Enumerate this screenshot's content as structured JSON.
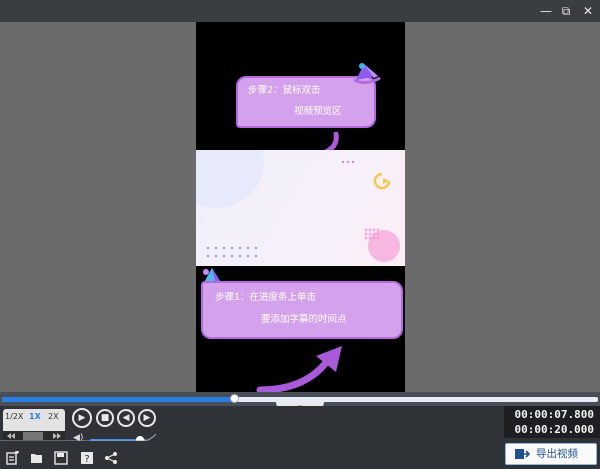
{
  "window": {
    "minimize_glyph": "—",
    "maximize_glyph": "⧉",
    "close_glyph": "✕"
  },
  "preview": {
    "step2_line1": "步骤2：鼠标双击",
    "step2_line2": "视频预览区",
    "step1_line1": "步骤1：在进度条上单击",
    "step1_line2": "要添加字幕的时间点"
  },
  "playback": {
    "progress": 0.39,
    "speed_options": [
      "1/2X",
      "1X",
      "2X"
    ],
    "selected_speed": "1X",
    "volume": 0.9,
    "current_time": "00:00:07.800",
    "total_time": "00:00:20.000"
  },
  "toolbar": {
    "export_label": "导出视频"
  },
  "colors": {
    "accent": "#2a7de1",
    "bubble": "#d4a1ec",
    "bubble_border": "#b46be0",
    "arrow": "#a95ad9"
  },
  "icons": {
    "new_project": "new-project-icon",
    "open_folder": "folder-open-icon",
    "save": "save-icon",
    "help": "help-icon",
    "share": "share-icon",
    "export": "export-video-icon"
  }
}
